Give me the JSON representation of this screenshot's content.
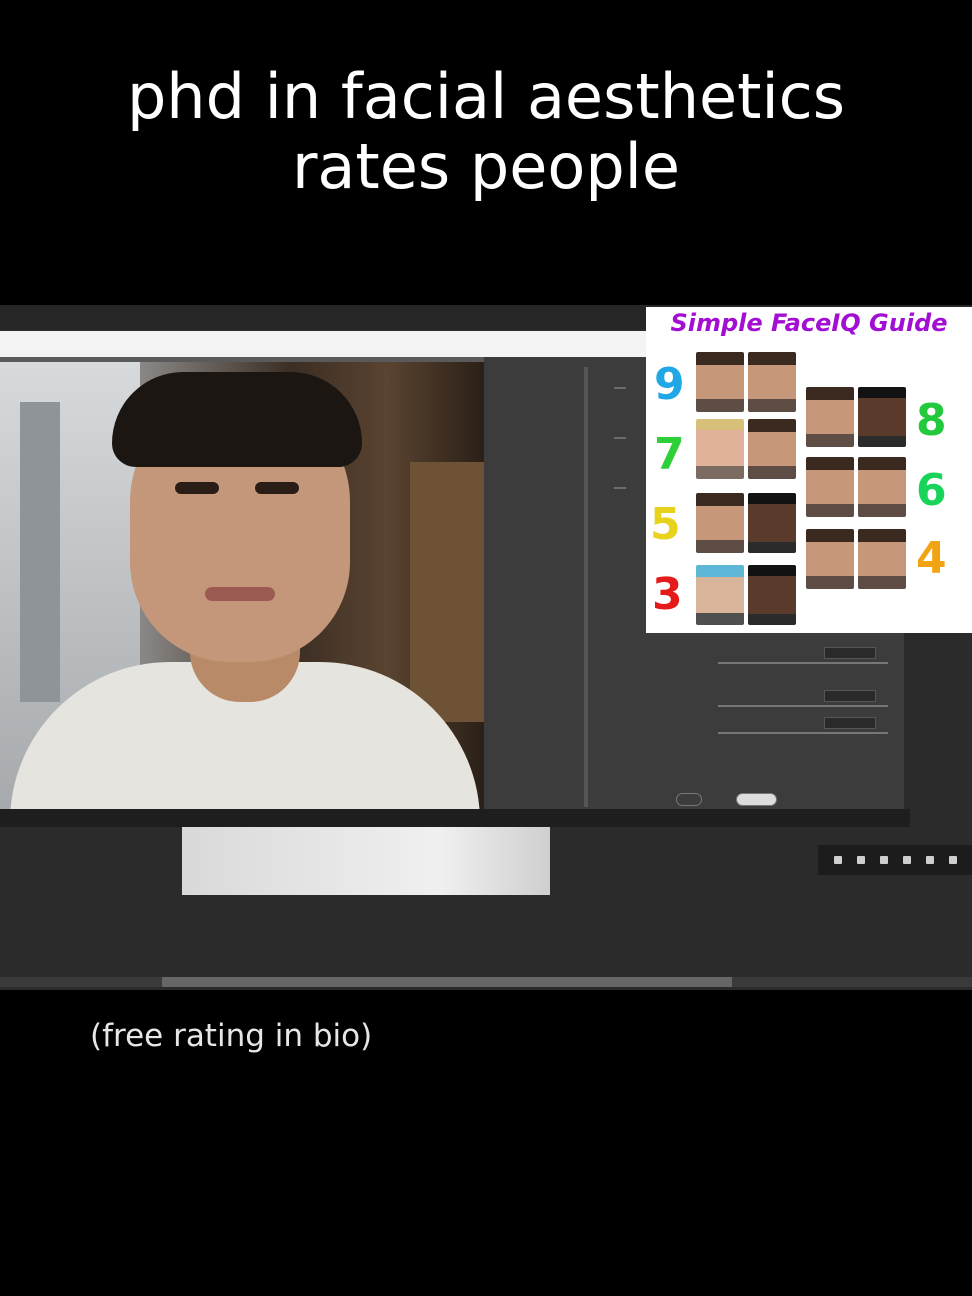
{
  "captions": {
    "top_line1": "phd in facial aesthetics",
    "top_line2": "rates people",
    "bottom": "(free rating in bio)"
  },
  "guide": {
    "title": "Simple FaceIQ Guide",
    "numbers": [
      {
        "value": "9",
        "color": "#1fa7e6"
      },
      {
        "value": "8",
        "color": "#22c93c"
      },
      {
        "value": "7",
        "color": "#2fcf3a"
      },
      {
        "value": "6",
        "color": "#19d45a"
      },
      {
        "value": "5",
        "color": "#e8d21c"
      },
      {
        "value": "4",
        "color": "#f0a313"
      },
      {
        "value": "3",
        "color": "#e51b1b"
      }
    ]
  },
  "colors": {
    "background": "#000000",
    "guide_title": "#a20fd3"
  }
}
